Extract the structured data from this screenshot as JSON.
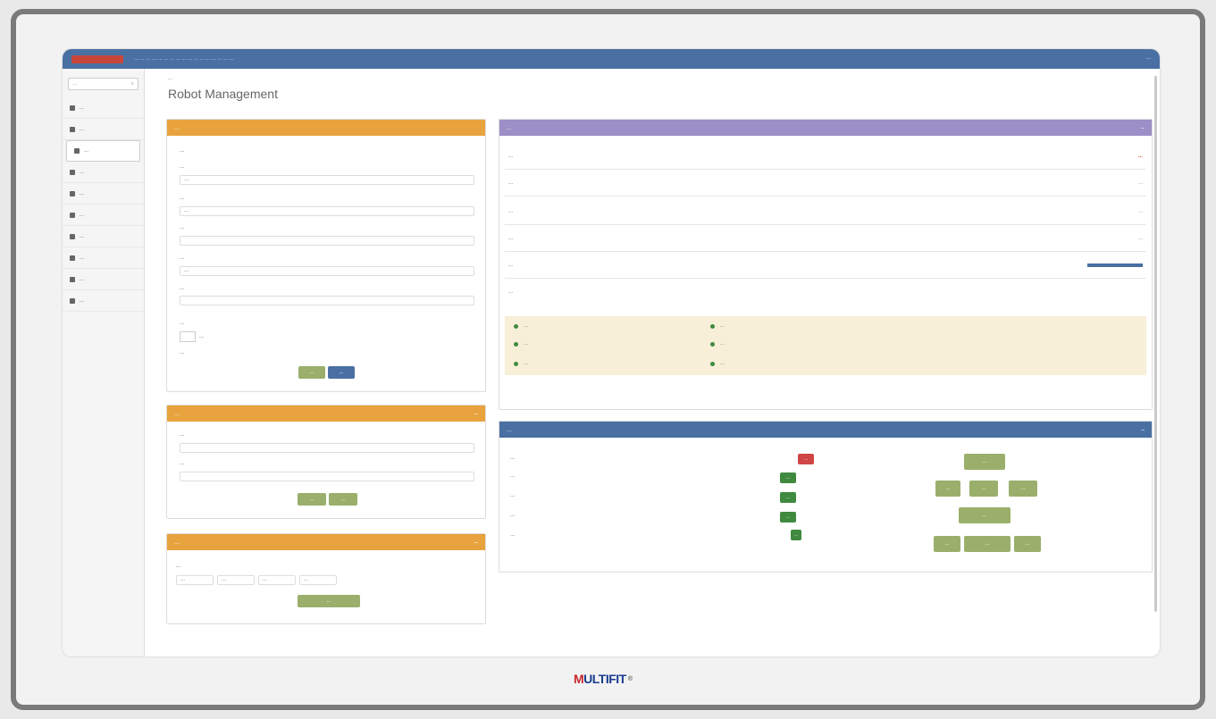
{
  "topbar": {
    "line1": "... ... ... ... ... ... ... ... ... ... ... ... ... ... ... ... ...",
    "right": "..."
  },
  "sidebar": {
    "search_placeholder": "...",
    "items": [
      "...",
      "...",
      "...",
      "...",
      "...",
      "...",
      "...",
      "...",
      "...",
      "..."
    ]
  },
  "page": {
    "breadcrumb": "...",
    "title": "Robot Management"
  },
  "panel1": {
    "header": "...",
    "fields": [
      {
        "label": "..."
      },
      {
        "label": "...",
        "value": "..."
      },
      {
        "label": "...",
        "value": "..."
      },
      {
        "label": "..."
      },
      {
        "label": "...",
        "value": "..."
      },
      {
        "label": "..."
      }
    ],
    "checkbox_label": "...",
    "checkbox_option": "...",
    "extra_label": "...",
    "btn1": "...",
    "btn2": "..."
  },
  "panel2": {
    "header": "...",
    "label1": "...",
    "label2": "...",
    "btn1": "...",
    "btn2": "..."
  },
  "panel3": {
    "header": "...",
    "label": "...",
    "input1": "...",
    "input2": "...",
    "input3": "...",
    "input4": "...",
    "btn": "..."
  },
  "status": {
    "header": "...",
    "rows": [
      {
        "label": "...",
        "value": "...",
        "warn": true
      },
      {
        "label": "...",
        "value": "..."
      },
      {
        "label": "...",
        "value": "..."
      },
      {
        "label": "...",
        "value": "..."
      },
      {
        "label": "...",
        "value": "..."
      },
      {
        "label": "...",
        "value": ""
      }
    ],
    "tips": [
      "...",
      "...",
      "...",
      "...",
      "...",
      "..."
    ]
  },
  "control": {
    "header": "...",
    "rows": [
      "...",
      "...",
      "...",
      "...",
      "..."
    ],
    "toggles": [
      "...",
      "...",
      "...",
      "...",
      "..."
    ],
    "buttons": [
      "...",
      "...",
      "...",
      "...",
      "...",
      "...",
      "...",
      "..."
    ]
  },
  "footer": {
    "brand_m": "M",
    "brand_rest": "ULTIFIT",
    "reg": "®"
  }
}
